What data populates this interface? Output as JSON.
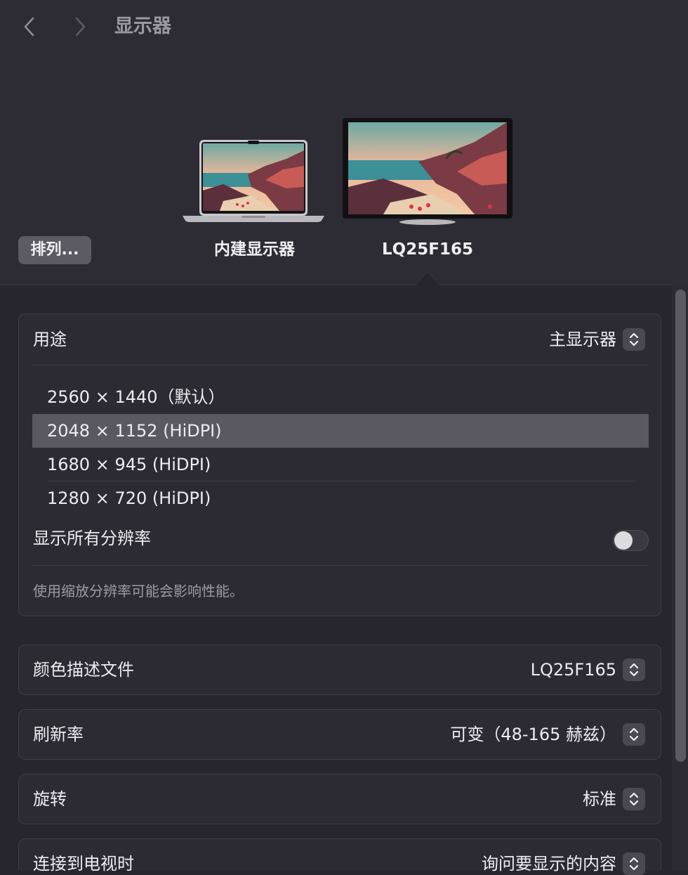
{
  "window": {
    "title": "显示器"
  },
  "displays": [
    {
      "label": "内建显示器"
    },
    {
      "label": "LQ25F165"
    }
  ],
  "arrange_button": "排列...",
  "usage": {
    "label": "用途",
    "value": "主显示器"
  },
  "resolutions": [
    {
      "label": "2560 × 1440（默认）"
    },
    {
      "label": "2048 × 1152 (HiDPI)"
    },
    {
      "label": "1680 × 945 (HiDPI)"
    },
    {
      "label": "1280 × 720 (HiDPI)"
    }
  ],
  "selected_resolution_index": 1,
  "show_all_resolutions": {
    "label": "显示所有分辨率",
    "enabled": false
  },
  "scaling_note": "使用缩放分辨率可能会影响性能。",
  "color_profile": {
    "label": "颜色描述文件",
    "value": "LQ25F165"
  },
  "refresh_rate": {
    "label": "刷新率",
    "value": "可变（48-165 赫兹）"
  },
  "rotation": {
    "label": "旋转",
    "value": "标准"
  },
  "tv_connect": {
    "label": "连接到电视时",
    "value": "询问要显示的内容"
  },
  "colors": {
    "background": "#27262f",
    "card": "#2c2b34",
    "selected_row": "#5a5962"
  }
}
